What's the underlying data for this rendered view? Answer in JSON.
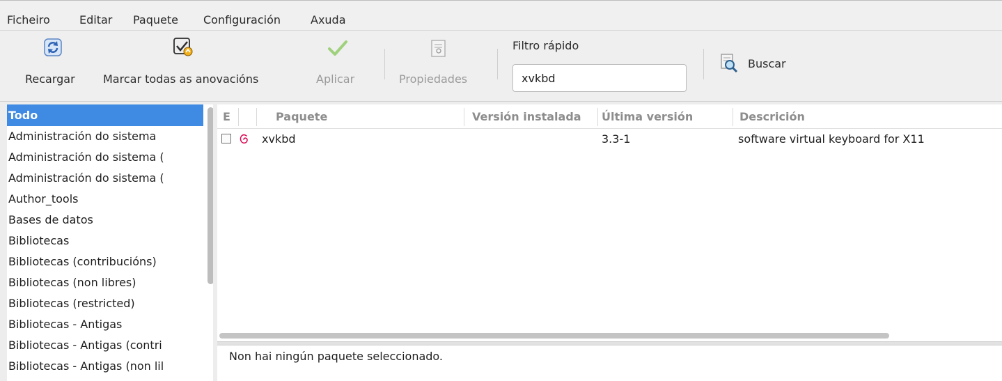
{
  "menubar": {
    "items": [
      "Ficheiro",
      "Editar",
      "Paquete",
      "Configuración",
      "Axuda"
    ]
  },
  "toolbar": {
    "reload_label": "Recargar",
    "mark_upgrades_label": "Marcar todas as anovacións",
    "apply_label": "Aplicar",
    "properties_label": "Propiedades",
    "filter_label": "Filtro rápido",
    "filter_value": "xvkbd",
    "search_label": "Buscar"
  },
  "categories": {
    "selected": "Todo",
    "items": [
      "Todo",
      "Administración do sistema",
      "Administración do sistema (",
      "Administración do sistema (",
      "Author_tools",
      "Bases de datos",
      "Bibliotecas",
      "Bibliotecas (contribucións)",
      "Bibliotecas (non libres)",
      "Bibliotecas (restricted)",
      "Bibliotecas - Antigas",
      "Bibliotecas - Antigas (contri",
      "Bibliotecas - Antigas (non lil"
    ]
  },
  "table": {
    "headers": [
      "E",
      "Paquete",
      "Versión instalada",
      "Última versión",
      "Descrición"
    ],
    "rows": [
      {
        "status_icon": "debian-swirl-icon",
        "package": "xvkbd",
        "installed_version": "",
        "latest_version": "3.3-1",
        "description": "software virtual keyboard for X11"
      }
    ]
  },
  "details": {
    "status_text": "Non hai ningún paquete seleccionado."
  },
  "colors": {
    "selection": "#3f8ae2",
    "debian_red": "#d70751"
  }
}
